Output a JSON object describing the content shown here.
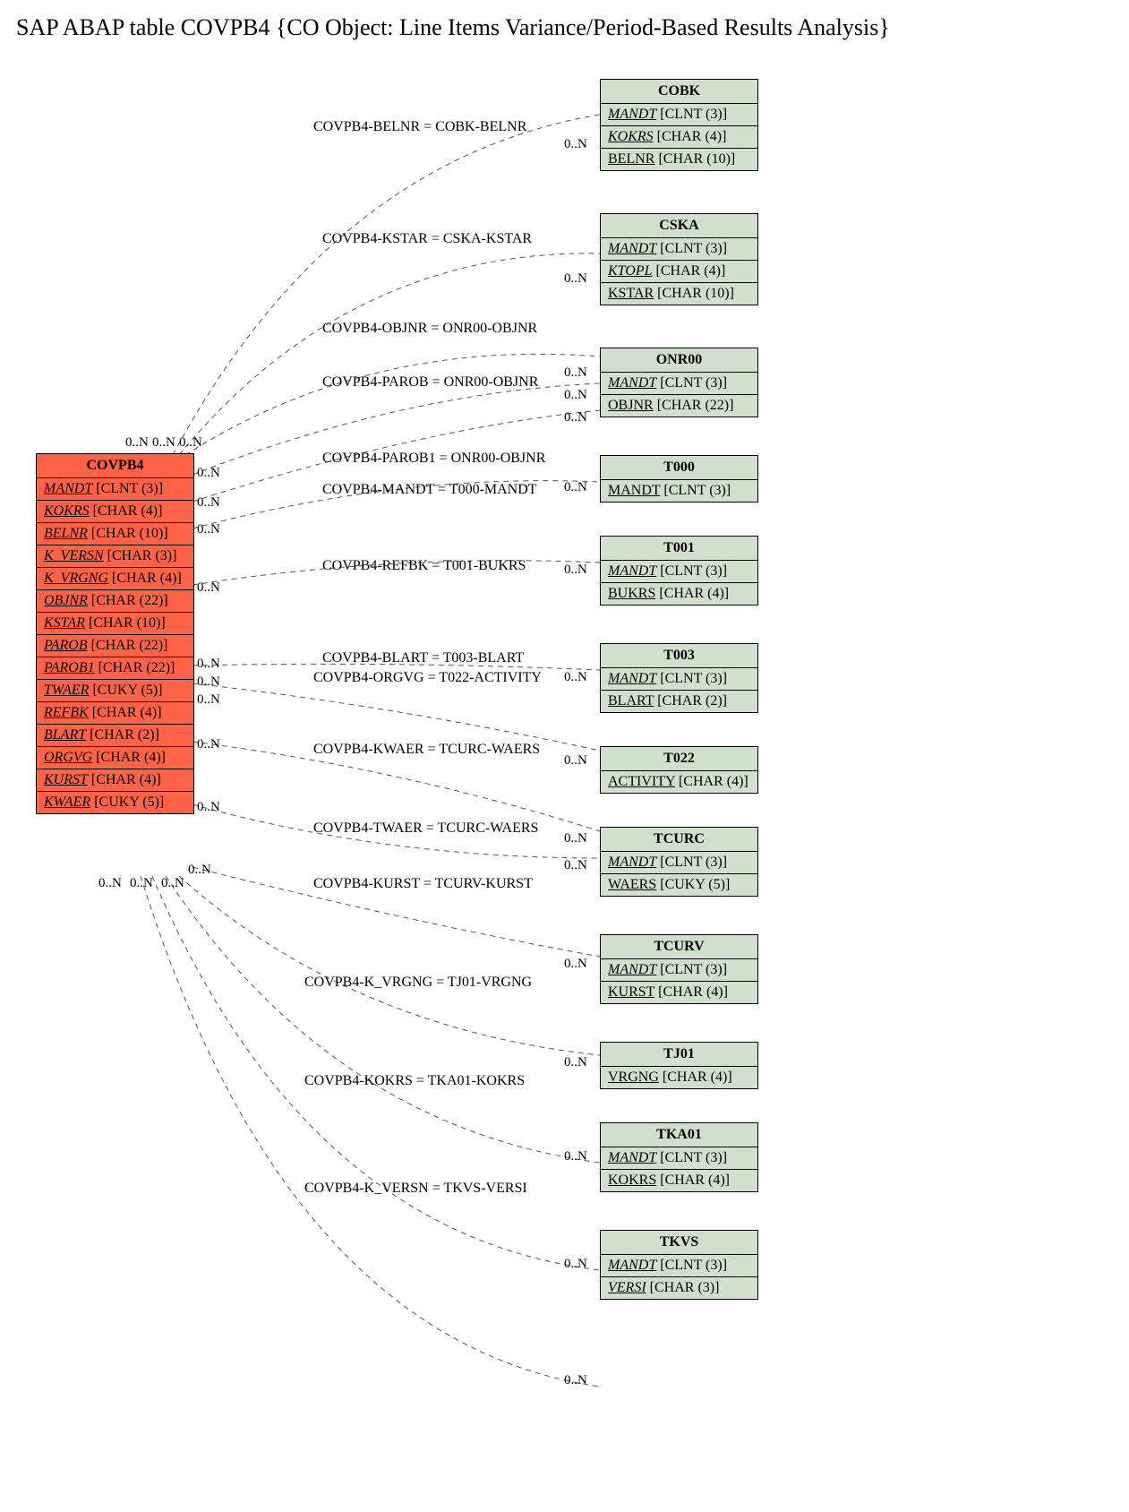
{
  "title": "SAP ABAP table COVPB4 {CO Object: Line Items Variance/Period-Based Results Analysis}",
  "main": {
    "name": "COVPB4",
    "fields": [
      {
        "name": "MANDT",
        "type": "[CLNT (3)]",
        "key": true
      },
      {
        "name": "KOKRS",
        "type": "[CHAR (4)]",
        "key": true
      },
      {
        "name": "BELNR",
        "type": "[CHAR (10)]",
        "key": true
      },
      {
        "name": "K_VERSN",
        "type": "[CHAR (3)]",
        "key": true
      },
      {
        "name": "K_VRGNG",
        "type": "[CHAR (4)]",
        "key": true
      },
      {
        "name": "OBJNR",
        "type": "[CHAR (22)]",
        "key": true
      },
      {
        "name": "KSTAR",
        "type": "[CHAR (10)]",
        "key": true
      },
      {
        "name": "PAROB",
        "type": "[CHAR (22)]",
        "key": true
      },
      {
        "name": "PAROB1",
        "type": "[CHAR (22)]",
        "key": true
      },
      {
        "name": "TWAER",
        "type": "[CUKY (5)]",
        "key": true
      },
      {
        "name": "REFBK",
        "type": "[CHAR (4)]",
        "key": true
      },
      {
        "name": "BLART",
        "type": "[CHAR (2)]",
        "key": true
      },
      {
        "name": "ORGVG",
        "type": "[CHAR (4)]",
        "key": true
      },
      {
        "name": "KURST",
        "type": "[CHAR (4)]",
        "key": true
      },
      {
        "name": "KWAER",
        "type": "[CUKY (5)]",
        "key": true
      }
    ]
  },
  "refs": [
    {
      "name": "COBK",
      "fields": [
        {
          "name": "MANDT",
          "type": "[CLNT (3)]",
          "key": true
        },
        {
          "name": "KOKRS",
          "type": "[CHAR (4)]",
          "key": true
        },
        {
          "name": "BELNR",
          "type": "[CHAR (10)]",
          "key": false
        }
      ]
    },
    {
      "name": "CSKA",
      "fields": [
        {
          "name": "MANDT",
          "type": "[CLNT (3)]",
          "key": true
        },
        {
          "name": "KTOPL",
          "type": "[CHAR (4)]",
          "key": true
        },
        {
          "name": "KSTAR",
          "type": "[CHAR (10)]",
          "key": false
        }
      ]
    },
    {
      "name": "ONR00",
      "fields": [
        {
          "name": "MANDT",
          "type": "[CLNT (3)]",
          "key": true
        },
        {
          "name": "OBJNR",
          "type": "[CHAR (22)]",
          "key": false
        }
      ]
    },
    {
      "name": "T000",
      "fields": [
        {
          "name": "MANDT",
          "type": "[CLNT (3)]",
          "key": false
        }
      ]
    },
    {
      "name": "T001",
      "fields": [
        {
          "name": "MANDT",
          "type": "[CLNT (3)]",
          "key": true
        },
        {
          "name": "BUKRS",
          "type": "[CHAR (4)]",
          "key": false
        }
      ]
    },
    {
      "name": "T003",
      "fields": [
        {
          "name": "MANDT",
          "type": "[CLNT (3)]",
          "key": true
        },
        {
          "name": "BLART",
          "type": "[CHAR (2)]",
          "key": false
        }
      ]
    },
    {
      "name": "T022",
      "fields": [
        {
          "name": "ACTIVITY",
          "type": "[CHAR (4)]",
          "key": false
        }
      ]
    },
    {
      "name": "TCURC",
      "fields": [
        {
          "name": "MANDT",
          "type": "[CLNT (3)]",
          "key": true
        },
        {
          "name": "WAERS",
          "type": "[CUKY (5)]",
          "key": false
        }
      ]
    },
    {
      "name": "TCURV",
      "fields": [
        {
          "name": "MANDT",
          "type": "[CLNT (3)]",
          "key": true
        },
        {
          "name": "KURST",
          "type": "[CHAR (4)]",
          "key": false
        }
      ]
    },
    {
      "name": "TJ01",
      "fields": [
        {
          "name": "VRGNG",
          "type": "[CHAR (4)]",
          "key": false
        }
      ]
    },
    {
      "name": "TKA01",
      "fields": [
        {
          "name": "MANDT",
          "type": "[CLNT (3)]",
          "key": true
        },
        {
          "name": "KOKRS",
          "type": "[CHAR (4)]",
          "key": false
        }
      ]
    },
    {
      "name": "TKVS",
      "fields": [
        {
          "name": "MANDT",
          "type": "[CLNT (3)]",
          "key": true
        },
        {
          "name": "VERSI",
          "type": "[CHAR (3)]",
          "key": true
        }
      ]
    }
  ],
  "rels": [
    {
      "label": "COVPB4-BELNR = COBK-BELNR"
    },
    {
      "label": "COVPB4-KSTAR = CSKA-KSTAR"
    },
    {
      "label": "COVPB4-OBJNR = ONR00-OBJNR"
    },
    {
      "label": "COVPB4-PAROB = ONR00-OBJNR"
    },
    {
      "label": "COVPB4-PAROB1 = ONR00-OBJNR"
    },
    {
      "label": "COVPB4-MANDT = T000-MANDT"
    },
    {
      "label": "COVPB4-REFBK = T001-BUKRS"
    },
    {
      "label": "COVPB4-BLART = T003-BLART"
    },
    {
      "label": "COVPB4-ORGVG = T022-ACTIVITY"
    },
    {
      "label": "COVPB4-KWAER = TCURC-WAERS"
    },
    {
      "label": "COVPB4-TWAER = TCURC-WAERS"
    },
    {
      "label": "COVPB4-KURST = TCURV-KURST"
    },
    {
      "label": "COVPB4-K_VRGNG = TJ01-VRGNG"
    },
    {
      "label": "COVPB4-KOKRS = TKA01-KOKRS"
    },
    {
      "label": "COVPB4-K_VERSN = TKVS-VERSI"
    }
  ],
  "card": "0..N"
}
